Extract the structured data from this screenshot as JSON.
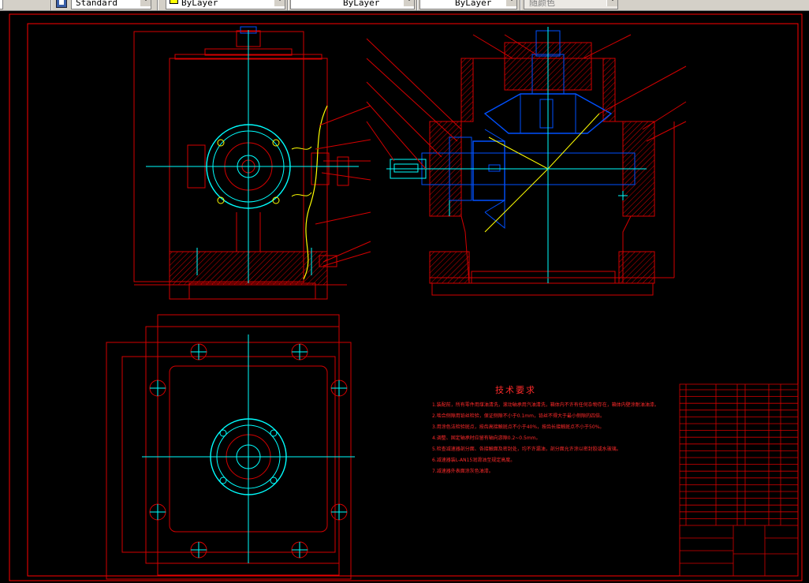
{
  "toolbar": {
    "text_style_value": "Standard",
    "layer_color_value": "ByLayer",
    "linetype_value": "ByLayer",
    "lineweight_value": "ByLayer",
    "plot_style_value": "随颜色",
    "layer_swatch_color": "#ffff00"
  },
  "drawing": {
    "tech_req_title": "技术要求",
    "tech_req_lines": [
      "1.装配前，所有零件用煤油清洗，滚动轴承用汽油清洗，箱体内不许有任何杂物存在，箱体内壁涂耐油油漆。",
      "2.啮合侧隙用铅丝检验，保证侧隙不小于0.1mm，铅丝不得大于最小侧隙的四倍。",
      "3.用涂色法检验斑点，按齿高接触斑点不小于40%，按齿长接触斑点不小于50%。",
      "4.调整、固定轴承时应留有轴向游隙0.2~0.5mm。",
      "5.检查减速器剖分面、各接触面及密封处，均不许漏油，剖分面允许涂以密封胶或水玻璃。",
      "6.减速器装L-AN15润滑油至规定高度。",
      "7.减速器外表面涂灰色油漆。"
    ],
    "colors": {
      "frame": "#ff0000",
      "outline": "#d40000",
      "centerline": "#00ffff",
      "gear": "#0050ff",
      "yellow": "#ffff00"
    }
  }
}
